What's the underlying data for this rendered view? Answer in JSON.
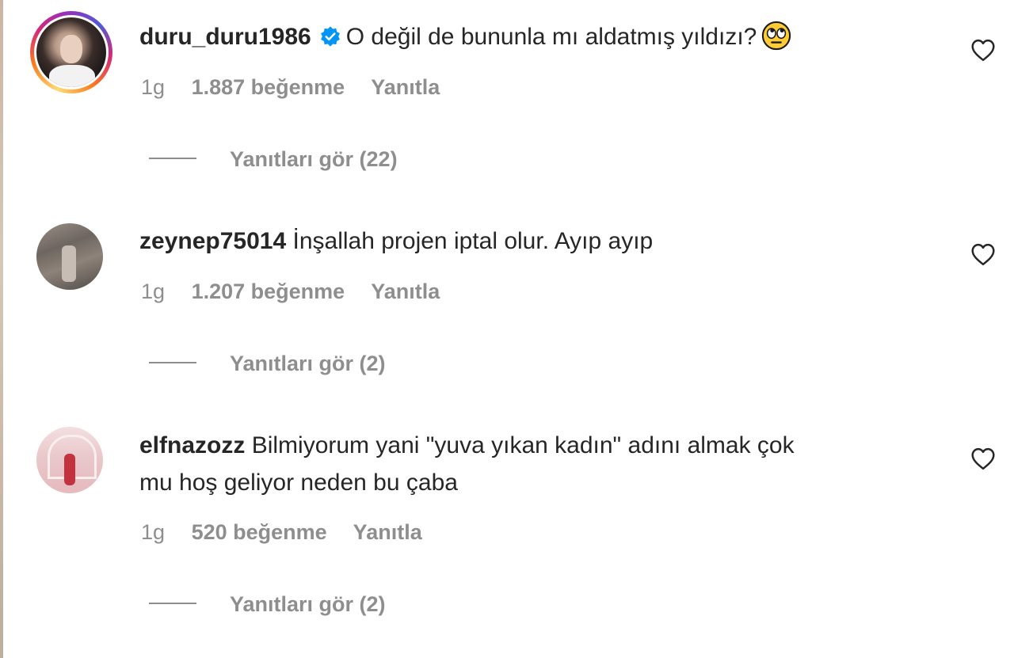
{
  "comments": [
    {
      "username": "duru_duru1986",
      "verified": true,
      "text_line1": "O değil de bununla mı aldatmış yıldızı?",
      "text_line2": "",
      "emoji_icon": "face-with-rolling-eyes-icon",
      "time": "1g",
      "likes": "1.887 beğenme",
      "reply_label": "Yanıtla",
      "view_replies": "Yanıtları gör (22)",
      "has_story_ring": true
    },
    {
      "username": "zeynep75014",
      "verified": false,
      "text_line1": "İnşallah projen iptal olur. Ayıp ayıp",
      "text_line2": "",
      "time": "1g",
      "likes": "1.207 beğenme",
      "reply_label": "Yanıtla",
      "view_replies": "Yanıtları gör (2)",
      "has_story_ring": false
    },
    {
      "username": "elfnazozz",
      "verified": false,
      "text_line1": "Bilmiyorum yani \"yuva yıkan kadın\" adını almak çok",
      "text_line2": "mu hoş geliyor neden bu çaba",
      "time": "1g",
      "likes": "520 beğenme",
      "reply_label": "Yanıtla",
      "view_replies": "Yanıtları gör (2)",
      "has_story_ring": false
    }
  ],
  "colors": {
    "text": "#262626",
    "secondary": "#8e8e8e",
    "verified_blue": "#0095f6"
  },
  "icons": {
    "like": "heart-outline-icon",
    "verified": "verified-badge-icon"
  }
}
